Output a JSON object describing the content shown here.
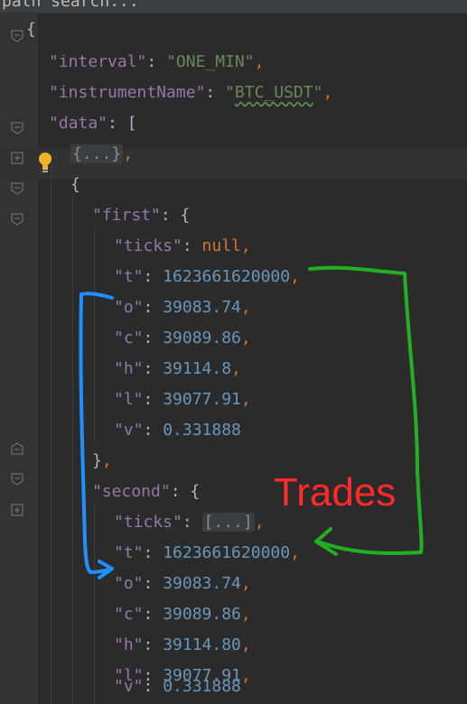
{
  "search": {
    "placeholder": "path search..."
  },
  "json_view": {
    "interval_key": "\"interval\"",
    "interval_value": "\"ONE_MIN\"",
    "instrument_key": "\"instrumentName\"",
    "instrument_value_open": "\"",
    "instrument_value_word": "BTC_USDT",
    "instrument_value_close": "\"",
    "data_key": "\"data\"",
    "collapsed_item": "{...}",
    "first_key": "\"first\"",
    "first": {
      "ticks_key": "\"ticks\"",
      "ticks_value": "null",
      "t_key": "\"t\"",
      "t_value": "1623661620000",
      "o_key": "\"o\"",
      "o_value": "39083.74",
      "c_key": "\"c\"",
      "c_value": "39089.86",
      "h_key": "\"h\"",
      "h_value": "39114.8",
      "l_key": "\"l\"",
      "l_value": "39077.91",
      "v_key": "\"v\"",
      "v_value": "0.331888"
    },
    "second_key": "\"second\"",
    "second": {
      "ticks_key": "\"ticks\"",
      "ticks_value": "[...]",
      "t_key": "\"t\"",
      "t_value": "1623661620000",
      "o_key": "\"o\"",
      "o_value": "39083.74",
      "c_key": "\"c\"",
      "c_value": "39089.86",
      "h_key": "\"h\"",
      "h_value": "39114.80",
      "l_key": "\"l\"",
      "l_value": "39077.91",
      "v_key": "\"v\"",
      "v_value": "0.331888"
    }
  },
  "annotation": {
    "label": "Trades",
    "label_color": "#ff2a2a",
    "arrow_green": "#22b022",
    "arrow_blue": "#1e90ff"
  },
  "colors": {
    "key": "#9876aa",
    "string": "#6a8759",
    "number": "#6897bb",
    "keyword": "#cc7832",
    "background": "#2b2b2b"
  }
}
